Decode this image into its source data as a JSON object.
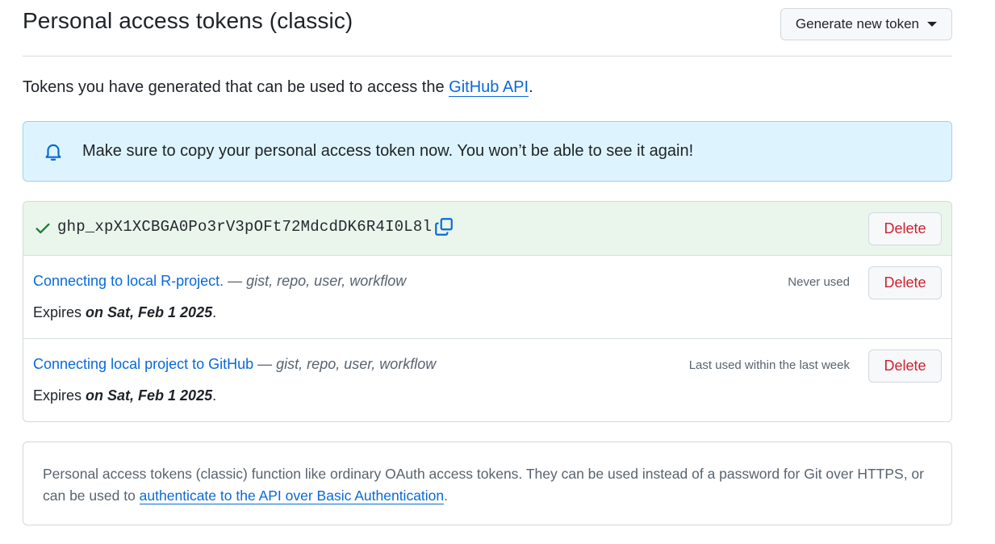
{
  "header": {
    "title": "Personal access tokens (classic)",
    "generate_button": "Generate new token"
  },
  "intro": {
    "text_before": "Tokens you have generated that can be used to access the ",
    "link": "GitHub API",
    "text_after": "."
  },
  "flash": {
    "icon": "bell-icon",
    "message": "Make sure to copy your personal access token now. You won’t be able to see it again!"
  },
  "new_token": {
    "value": "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",
    "copy_icon": "copy-icon",
    "delete_label": "Delete"
  },
  "tokens": [
    {
      "name": "Connecting to local R-project.",
      "dash": " — ",
      "scopes": "gist, repo, user, workflow",
      "usage": "Never used",
      "expires_prefix": "Expires ",
      "expires_date": "on Sat, Feb 1 2025",
      "expires_suffix": ".",
      "delete_label": "Delete"
    },
    {
      "name": "Connecting local project to GitHub",
      "dash": " — ",
      "scopes": "gist, repo, user, workflow",
      "usage": "Last used within the last week",
      "expires_prefix": "Expires ",
      "expires_date": "on Sat, Feb 1 2025",
      "expires_suffix": ".",
      "delete_label": "Delete"
    }
  ],
  "note": {
    "text_before": "Personal access tokens (classic) function like ordinary OAuth access tokens. They can be used instead of a password for Git over HTTPS, or can be used to ",
    "link": "authenticate to the API over Basic Authentication",
    "text_after": "."
  },
  "colors": {
    "accent": "#0969da",
    "danger": "#cf222e",
    "success": "#1a7f37",
    "flash_bg": "#ddf4ff",
    "new_token_bg": "#eaf6ec"
  }
}
